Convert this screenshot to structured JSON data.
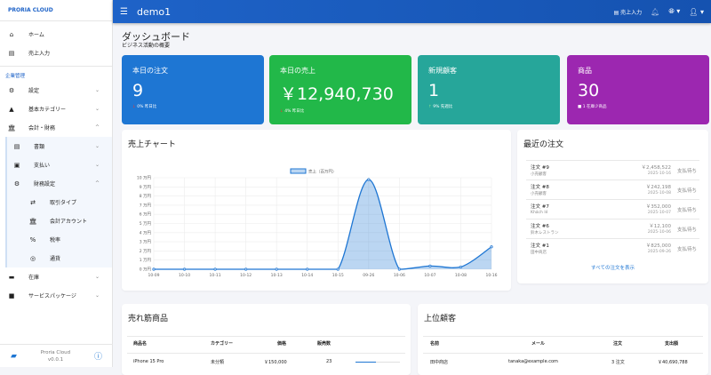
{
  "sidebar": {
    "brand": "PRORIA CLOUD",
    "top": [
      {
        "label": "ホーム",
        "icon": "home-icon"
      },
      {
        "label": "売上入力",
        "icon": "register-icon"
      }
    ],
    "section": "企業管理",
    "items": [
      {
        "label": "設定"
      },
      {
        "label": "基本カテゴリー"
      },
      {
        "label": "会計・財務"
      }
    ],
    "accounting": [
      {
        "label": "書類"
      },
      {
        "label": "支払い"
      },
      {
        "label": "財務設定"
      }
    ],
    "finance": [
      {
        "label": "取引タイプ"
      },
      {
        "label": "会計アカウント"
      },
      {
        "label": "税率"
      },
      {
        "label": "通貨"
      }
    ],
    "bottom": [
      {
        "label": "在庫"
      },
      {
        "label": "サービスパッケージ"
      }
    ],
    "footer": {
      "name": "Proria Cloud",
      "version": "v0.0.1"
    }
  },
  "header": {
    "title": "demo1",
    "sales_entry": "売上入力"
  },
  "page": {
    "title": "ダッシュボード",
    "subtitle": "ビジネス活動の概要"
  },
  "cards": [
    {
      "label": "本日の注文",
      "value": "9",
      "delta": "0% 昨日比",
      "color": "#1e76d3"
    },
    {
      "label": "本日の売上",
      "value": "￥12,940,730",
      "delta": "4% 昨日比",
      "color": "#22b849"
    },
    {
      "label": "新規顧客",
      "value": "1",
      "delta": "9% 先週比",
      "color": "#26a69a"
    },
    {
      "label": "商品",
      "value": "30",
      "delta": "1 在庫少商品",
      "color": "#9c27b0"
    }
  ],
  "chart_title": "売上チャート",
  "chart_data": {
    "type": "area",
    "series": [
      {
        "name": "売上（百万円）",
        "values": [
          0,
          0,
          0,
          0,
          0,
          0,
          0,
          9.8,
          0,
          0.35,
          0.25,
          2.45
        ]
      }
    ],
    "categories": [
      "10-09",
      "10-10",
      "10-11",
      "10-12",
      "10-13",
      "10-14",
      "10-15",
      "09-26",
      "10-06",
      "10-07",
      "10-08",
      "10-16"
    ],
    "yticks": [
      "0 万円",
      "1 万円",
      "2 万円",
      "3 万円",
      "4 万円",
      "5 万円",
      "6 万円",
      "7 万円",
      "8 万円",
      "9 万円",
      "10 万円"
    ],
    "ylim": [
      0,
      10
    ],
    "grid": true,
    "legend": "top",
    "color": "#1e76d3"
  },
  "recent": {
    "title": "最近の注文",
    "link": "すべての注文を表示",
    "orders": [
      {
        "no": "注文 #9",
        "customer": "小売顧客",
        "amount": "￥2,458,522",
        "date": "2025-10-16",
        "status": "支払待ち"
      },
      {
        "no": "注文 #8",
        "customer": "小売顧客",
        "amount": "￥242,198",
        "date": "2025-10-08",
        "status": "支払待ち"
      },
      {
        "no": "注文 #7",
        "customer": "Khách lẻ",
        "amount": "￥352,000",
        "date": "2025-10-07",
        "status": "支払待ち"
      },
      {
        "no": "注文 #6",
        "customer": "鈴木レストラン",
        "amount": "￥12,100",
        "date": "2025-10-06",
        "status": "支払待ち"
      },
      {
        "no": "注文 #1",
        "customer": "田中商店",
        "amount": "￥825,000",
        "date": "2025-09-26",
        "status": "支払待ち"
      }
    ]
  },
  "products": {
    "title": "売れ筋商品",
    "headers": [
      "商品名",
      "カテゴリー",
      "価格",
      "販売数"
    ],
    "rows": [
      {
        "name": "iPhone 15 Pro",
        "category": "未分類",
        "price": "￥150,000",
        "sold": "23",
        "share": 0.45
      }
    ]
  },
  "customers": {
    "title": "上位顧客",
    "headers": [
      "名前",
      "メール",
      "注文",
      "支出額"
    ],
    "rows": [
      {
        "name": "田中商店",
        "email": "tanaka@example.com",
        "orders": "3 注文",
        "spent": "￥40,690,788"
      }
    ]
  }
}
